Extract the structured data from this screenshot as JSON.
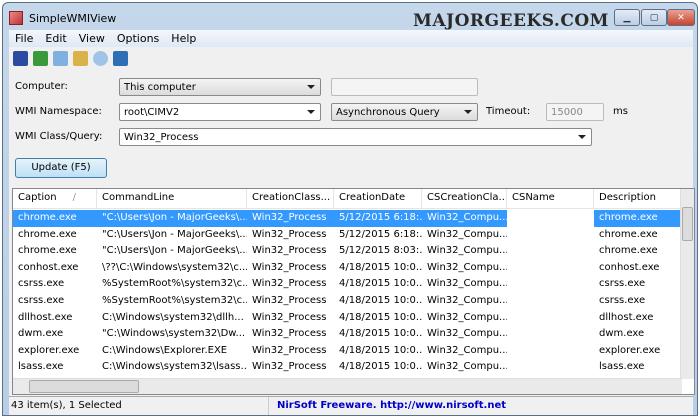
{
  "window": {
    "title": "SimpleWMIView",
    "watermark": "MAJORGEEKS.COM"
  },
  "menu": [
    "File",
    "Edit",
    "View",
    "Options",
    "Help"
  ],
  "toolbar": [
    "save-icon",
    "refresh-icon",
    "copy-icon",
    "properties-icon",
    "find-icon",
    "exit-icon"
  ],
  "form": {
    "computer_label": "Computer:",
    "computer_value": "This computer",
    "computer_name_value": "",
    "namespace_label": "WMI Namespace:",
    "namespace_value": "root\\CIMV2",
    "query_mode_value": "Asynchronous Query",
    "timeout_label": "Timeout:",
    "timeout_value": "15000",
    "timeout_unit": "ms",
    "class_label": "WMI Class/Query:",
    "class_value": "Win32_Process",
    "update_label": "Update (F5)"
  },
  "table": {
    "columns": [
      "Caption",
      "CommandLine",
      "CreationClass...",
      "CreationDate",
      "CSCreationCla...",
      "CSName",
      "Description"
    ],
    "sort_indicator": "/",
    "rows": [
      [
        "chrome.exe",
        "\"C:\\Users\\Jon - MajorGeeks\\...",
        "Win32_Process",
        "5/12/2015 6:18:...",
        "Win32_Compu...",
        "",
        "chrome.exe"
      ],
      [
        "chrome.exe",
        "\"C:\\Users\\Jon - MajorGeeks\\...",
        "Win32_Process",
        "5/12/2015 6:18:...",
        "Win32_Compu...",
        "",
        "chrome.exe"
      ],
      [
        "chrome.exe",
        "\"C:\\Users\\Jon - MajorGeeks\\...",
        "Win32_Process",
        "5/12/2015 8:03:...",
        "Win32_Compu...",
        "",
        "chrome.exe"
      ],
      [
        "conhost.exe",
        "\\??\\C:\\Windows\\system32\\c...",
        "Win32_Process",
        "4/18/2015 10:0...",
        "Win32_Compu...",
        "",
        "conhost.exe"
      ],
      [
        "csrss.exe",
        "%SystemRoot%\\system32\\c...",
        "Win32_Process",
        "4/18/2015 10:0...",
        "Win32_Compu...",
        "",
        "csrss.exe"
      ],
      [
        "csrss.exe",
        "%SystemRoot%\\system32\\c...",
        "Win32_Process",
        "4/18/2015 10:0...",
        "Win32_Compu...",
        "",
        "csrss.exe"
      ],
      [
        "dllhost.exe",
        "C:\\Windows\\system32\\dllh...",
        "Win32_Process",
        "4/18/2015 10:0...",
        "Win32_Compu...",
        "",
        "dllhost.exe"
      ],
      [
        "dwm.exe",
        "\"C:\\Windows\\system32\\Dw...",
        "Win32_Process",
        "4/18/2015 10:0...",
        "Win32_Compu...",
        "",
        "dwm.exe"
      ],
      [
        "explorer.exe",
        "C:\\Windows\\Explorer.EXE",
        "Win32_Process",
        "4/18/2015 10:0...",
        "Win32_Compu...",
        "",
        "explorer.exe"
      ],
      [
        "lsass.exe",
        "C:\\Windows\\system32\\lsass...",
        "Win32_Process",
        "4/18/2015 10:0...",
        "Win32_Compu...",
        "",
        "lsass.exe"
      ]
    ],
    "selected_row": 0
  },
  "status": {
    "items": "43 item(s), 1 Selected",
    "credit": "NirSoft Freeware.  http://www.nirsoft.net"
  },
  "colors": {
    "selection": "#3399ff",
    "link": "#0000cc"
  }
}
